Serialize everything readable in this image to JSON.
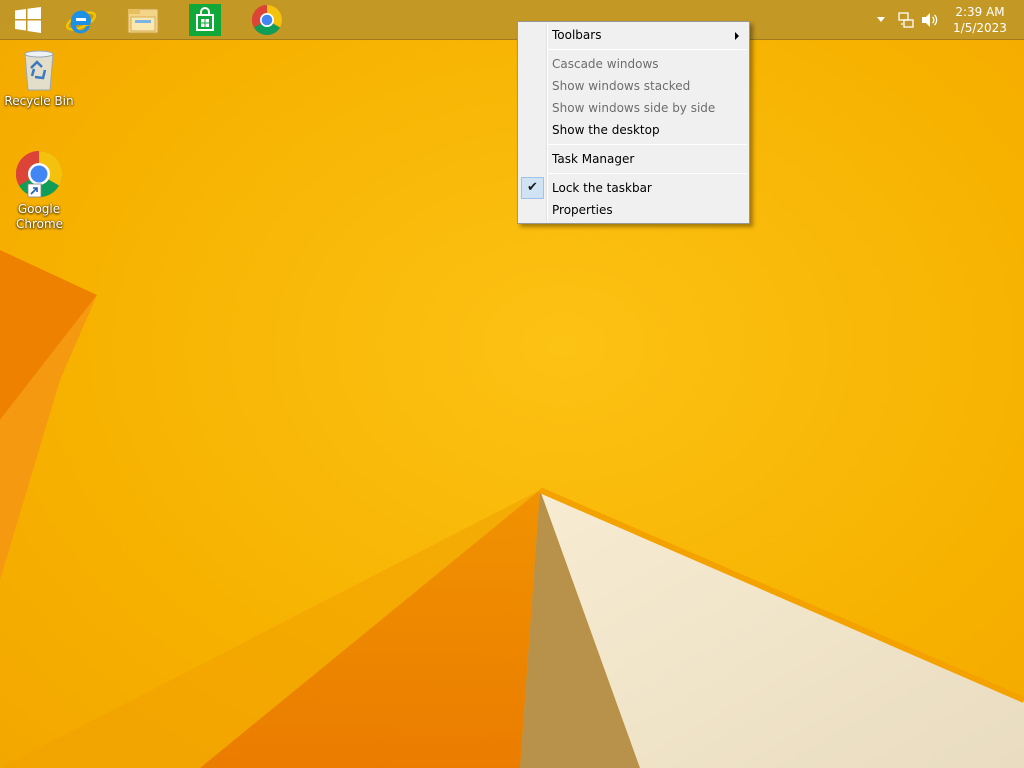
{
  "taskbar": {
    "pinned": [
      {
        "name": "start-button",
        "icon": "windows-logo-icon"
      },
      {
        "name": "internet-explorer",
        "icon": "internet-explorer-icon"
      },
      {
        "name": "file-explorer",
        "icon": "folder-icon"
      },
      {
        "name": "store",
        "icon": "store-bag-icon"
      },
      {
        "name": "google-chrome",
        "icon": "chrome-icon"
      }
    ],
    "tray": {
      "time": "2:39 AM",
      "date": "1/5/2023"
    }
  },
  "desktop": {
    "icons": [
      {
        "label": "Recycle Bin",
        "icon": "recycle-bin-icon"
      },
      {
        "label": "Google Chrome",
        "icon": "chrome-icon"
      }
    ]
  },
  "context_menu": {
    "items": [
      {
        "label": "Toolbars",
        "enabled": true,
        "submenu": true
      },
      {
        "label": "Cascade windows",
        "enabled": false
      },
      {
        "label": "Show windows stacked",
        "enabled": false
      },
      {
        "label": "Show windows side by side",
        "enabled": false
      },
      {
        "label": "Show the desktop",
        "enabled": true
      },
      {
        "label": "Task Manager",
        "enabled": true
      },
      {
        "label": "Lock the taskbar",
        "enabled": true,
        "checked": true
      },
      {
        "label": "Properties",
        "enabled": true
      }
    ]
  },
  "colors": {
    "wallpaper": "#f7b500",
    "taskbar": "#be9628",
    "menu_background": "#f0f0f0",
    "disabled_text": "#6d6d6d"
  }
}
